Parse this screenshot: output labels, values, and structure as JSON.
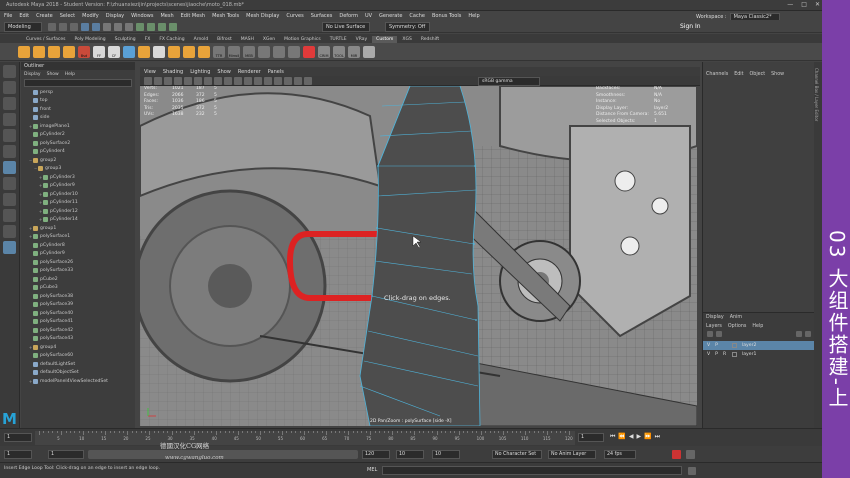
{
  "window": {
    "title": "Autodesk Maya 2018 - Student Version: F:\\zhuanxiezijin\\projects\\scenes\\jiaoche\\moto_018.mb*",
    "controls": [
      "—",
      "□",
      "✕"
    ]
  },
  "menubar": [
    "File",
    "Edit",
    "Create",
    "Select",
    "Modify",
    "Display",
    "Windows",
    "Mesh",
    "Edit Mesh",
    "Mesh Tools",
    "Mesh Display",
    "Curves",
    "Surfaces",
    "Deform",
    "UV",
    "Generate",
    "Cache",
    "Bonus Tools",
    "Help"
  ],
  "workspace": {
    "label": "Workspace :",
    "value": "Maya Classic2*"
  },
  "statusline": {
    "mode": "Modeling",
    "live_surface": "No Live Surface",
    "symmetry": "Symmetry: Off",
    "sign_in": "Sign In"
  },
  "shelf_tabs": [
    "Curves / Surfaces",
    "Poly Modeling",
    "Sculpting",
    "FX",
    "FX Caching",
    "Arnold",
    "Bifrost",
    "MASH",
    "XGen",
    "Motion Graphics",
    "TURTLE",
    "VRay",
    "Custom",
    "XGS",
    "Redshift"
  ],
  "shelf_active": "Custom",
  "shelf_buttons": [
    {
      "label": "",
      "color": "#e8a33a"
    },
    {
      "label": "",
      "color": "#e8a33a"
    },
    {
      "label": "",
      "color": "#e8a33a"
    },
    {
      "label": "",
      "color": "#e8a33a"
    },
    {
      "label": "Bsd",
      "color": "#c84a3a"
    },
    {
      "label": "FF",
      "color": "#d9d9d9"
    },
    {
      "label": "CF",
      "color": "#d9d9d9"
    },
    {
      "label": "",
      "color": "#5aa0d6"
    },
    {
      "label": "",
      "color": "#e8a33a"
    },
    {
      "label": "",
      "color": "#d9d9d9"
    },
    {
      "label": "",
      "color": "#e8a33a"
    },
    {
      "label": "",
      "color": "#e8a33a"
    },
    {
      "label": "",
      "color": "#e8a33a"
    },
    {
      "label": "TTR",
      "color": "#777777"
    },
    {
      "label": "Mirroll",
      "color": "#777777"
    },
    {
      "label": "MEB",
      "color": "#777777"
    },
    {
      "label": "",
      "color": "#777777"
    },
    {
      "label": "",
      "color": "#777777"
    },
    {
      "label": "",
      "color": "#777777"
    },
    {
      "label": "",
      "color": "#e03a3a"
    },
    {
      "label": "CRIM",
      "color": "#888888"
    },
    {
      "label": "TOOL",
      "color": "#888888"
    },
    {
      "label": "MIR",
      "color": "#888888"
    },
    {
      "label": "",
      "color": "#aaaaaa"
    }
  ],
  "outliner": {
    "title": "Outliner",
    "menu": [
      "Display",
      "Show",
      "Help"
    ],
    "items": [
      {
        "label": "persp",
        "type": "cam",
        "indent": 1,
        "exp": ""
      },
      {
        "label": "top",
        "type": "cam",
        "indent": 1,
        "exp": ""
      },
      {
        "label": "front",
        "type": "cam",
        "indent": 1,
        "exp": ""
      },
      {
        "label": "side",
        "type": "cam",
        "indent": 1,
        "exp": ""
      },
      {
        "label": "imagePlane1",
        "type": "geo",
        "indent": 1,
        "exp": "+"
      },
      {
        "label": "pCylinder2",
        "type": "geo",
        "indent": 1,
        "exp": ""
      },
      {
        "label": "polySurface2",
        "type": "geo",
        "indent": 1,
        "exp": ""
      },
      {
        "label": "pCylinder4",
        "type": "geo",
        "indent": 1,
        "exp": ""
      },
      {
        "label": "group2",
        "type": "grp",
        "indent": 1,
        "exp": "−"
      },
      {
        "label": "group3",
        "type": "grp",
        "indent": 2,
        "exp": "−"
      },
      {
        "label": "pCylinder3",
        "type": "geo",
        "indent": 3,
        "exp": "+"
      },
      {
        "label": "pCylinder9",
        "type": "geo",
        "indent": 3,
        "exp": "+"
      },
      {
        "label": "pCylinder10",
        "type": "geo",
        "indent": 3,
        "exp": "+"
      },
      {
        "label": "pCylinder11",
        "type": "geo",
        "indent": 3,
        "exp": "+"
      },
      {
        "label": "pCylinder12",
        "type": "geo",
        "indent": 3,
        "exp": "+"
      },
      {
        "label": "pCylinder14",
        "type": "geo",
        "indent": 3,
        "exp": "+"
      },
      {
        "label": "group1",
        "type": "grp",
        "indent": 1,
        "exp": "+"
      },
      {
        "label": "polySurface1",
        "type": "geo",
        "indent": 1,
        "exp": "+"
      },
      {
        "label": "pCylinder8",
        "type": "geo",
        "indent": 1,
        "exp": ""
      },
      {
        "label": "pCylinder9",
        "type": "geo",
        "indent": 1,
        "exp": ""
      },
      {
        "label": "polySurface26",
        "type": "geo",
        "indent": 1,
        "exp": ""
      },
      {
        "label": "polySurface33",
        "type": "geo",
        "indent": 1,
        "exp": ""
      },
      {
        "label": "pCube2",
        "type": "geo",
        "indent": 1,
        "exp": ""
      },
      {
        "label": "pCube3",
        "type": "geo",
        "indent": 1,
        "exp": ""
      },
      {
        "label": "polySurface38",
        "type": "geo",
        "indent": 1,
        "exp": ""
      },
      {
        "label": "polySurface39",
        "type": "geo",
        "indent": 1,
        "exp": ""
      },
      {
        "label": "polySurface40",
        "type": "geo",
        "indent": 1,
        "exp": ""
      },
      {
        "label": "polySurface41",
        "type": "geo",
        "indent": 1,
        "exp": ""
      },
      {
        "label": "polySurface42",
        "type": "geo",
        "indent": 1,
        "exp": ""
      },
      {
        "label": "polySurface43",
        "type": "geo",
        "indent": 1,
        "exp": ""
      },
      {
        "label": "group4",
        "type": "grp",
        "indent": 1,
        "exp": "+"
      },
      {
        "label": "polySurface60",
        "type": "geo",
        "indent": 1,
        "exp": ""
      },
      {
        "label": "defaultLightSet",
        "type": "cam",
        "indent": 1,
        "exp": ""
      },
      {
        "label": "defaultObjectSet",
        "type": "cam",
        "indent": 1,
        "exp": ""
      },
      {
        "label": "modelPanel4ViewSelectedSet",
        "type": "cam",
        "indent": 1,
        "exp": "+"
      }
    ]
  },
  "viewport": {
    "menu": [
      "View",
      "Shading",
      "Lighting",
      "Show",
      "Renderer",
      "Panels"
    ],
    "colorspace": "sRGB gamma",
    "hud_left": [
      {
        "label": "Verts:",
        "a": "1021",
        "b": "187",
        "c": "5"
      },
      {
        "label": "Edges:",
        "a": "2066",
        "b": "372",
        "c": "5"
      },
      {
        "label": "Faces:",
        "a": "1036",
        "b": "186",
        "c": "5"
      },
      {
        "label": "Tris:",
        "a": "2035",
        "b": "372",
        "c": "5"
      },
      {
        "label": "UVs:",
        "a": "1638",
        "b": "232",
        "c": "5"
      }
    ],
    "hud_right": [
      {
        "label": "Backfaces:",
        "value": "N/A"
      },
      {
        "label": "Smoothness:",
        "value": "N/A"
      },
      {
        "label": "Instance:",
        "value": "No"
      },
      {
        "label": "Display Layer:",
        "value": "layer2"
      },
      {
        "label": "Distance From Camera:",
        "value": "5.651"
      },
      {
        "label": "Selected Objects:",
        "value": "1"
      }
    ],
    "hint": "Click-drag on edges.",
    "camera_label": "2D Pan/Zoom : polySurface [side -X]"
  },
  "channel_box": {
    "menu": [
      "Channels",
      "Edit",
      "Object",
      "Show"
    ],
    "vertical_tabs": "Channel Box / Layer Editor",
    "layers_tabs": [
      "Display",
      "Anim"
    ],
    "layers_menu": [
      "Layers",
      "Options",
      "Help"
    ],
    "layers": [
      {
        "v": "V",
        "p": "P",
        "r": "",
        "name": "layer2",
        "selected": true
      },
      {
        "v": "V",
        "p": "P",
        "r": "R",
        "name": "layer1",
        "selected": false
      }
    ]
  },
  "banner": {
    "text": "03 大组件搭建-上",
    "color": "#7b3fa8"
  },
  "timeslider": {
    "start": "1",
    "end": "120",
    "ticks": [
      "5",
      "10",
      "15",
      "20",
      "25",
      "30",
      "35",
      "40",
      "45",
      "50",
      "55",
      "60",
      "65",
      "70",
      "75",
      "80",
      "85",
      "90",
      "95",
      "100",
      "105",
      "110",
      "115",
      "120"
    ],
    "current": "1"
  },
  "rangebar": {
    "start": "1",
    "inner_start": "1",
    "inner_end": "120",
    "end": "120",
    "anim_end": "10",
    "max": "10",
    "character_set": "No Character Set",
    "anim_layer": "No Anim Layer",
    "fps": "24 fps"
  },
  "cmdline": {
    "lang": "MEL",
    "help": "Insert Edge Loop Tool: Click-drag on an edge to insert an edge loop."
  },
  "watermark": {
    "cn": "德國汉化CG网络",
    "url": "www.cgwangluo.com"
  }
}
